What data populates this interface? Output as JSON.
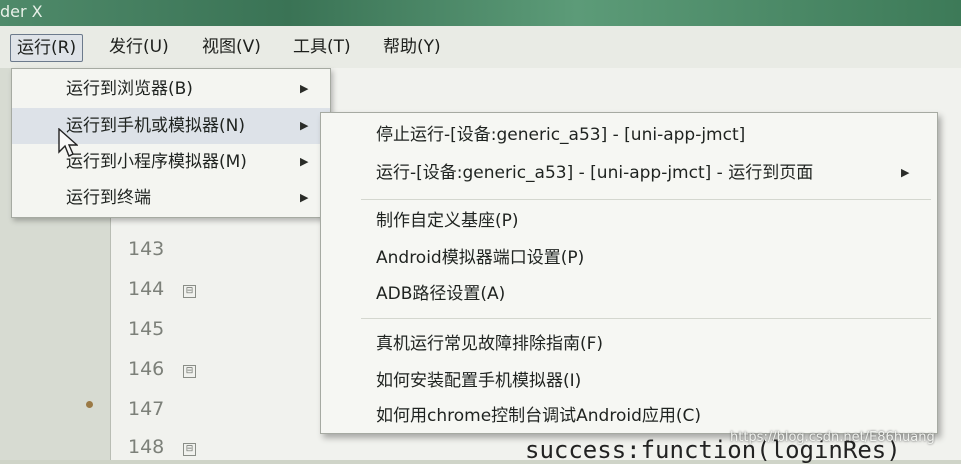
{
  "window": {
    "title": "der X"
  },
  "menubar": {
    "items": [
      {
        "label": "运行(R)",
        "active": true
      },
      {
        "label": "发行(U)"
      },
      {
        "label": "视图(V)"
      },
      {
        "label": "工具(T)"
      },
      {
        "label": "帮助(Y)"
      }
    ]
  },
  "run_menu": {
    "items": [
      {
        "label": "运行到浏览器(B)",
        "arrow": "▶"
      },
      {
        "label": "运行到手机或模拟器(N)",
        "arrow": "▶"
      },
      {
        "label": "运行到小程序模拟器(M)",
        "arrow": "▶"
      },
      {
        "label": "运行到终端",
        "arrow": "▶"
      }
    ]
  },
  "submenu": {
    "items": [
      {
        "label": "停止运行-[设备:generic_a53] - [uni-app-jmct]"
      },
      {
        "label": "运行-[设备:generic_a53] - [uni-app-jmct] - 运行到页面",
        "arrow": "▶"
      },
      {
        "label": "制作自定义基座(P)"
      },
      {
        "label": "Android模拟器端口设置(P)"
      },
      {
        "label": "ADB路径设置(A)"
      },
      {
        "label": "真机运行常见故障排除指南(F)"
      },
      {
        "label": "如何安装配置手机模拟器(I)"
      },
      {
        "label": "如何用chrome控制台调试Android应用(C)"
      }
    ]
  },
  "editor": {
    "line_numbers": [
      "143",
      "144",
      "145",
      "146",
      "147",
      "148"
    ],
    "fold_marker": "⊟",
    "code_fragment": "success:function(loginRes)"
  },
  "watermark": "https://blog.csdn.net/E86huang",
  "colors": {
    "titlebar": "#3a7355",
    "menu_hover": "#dde2e8"
  }
}
